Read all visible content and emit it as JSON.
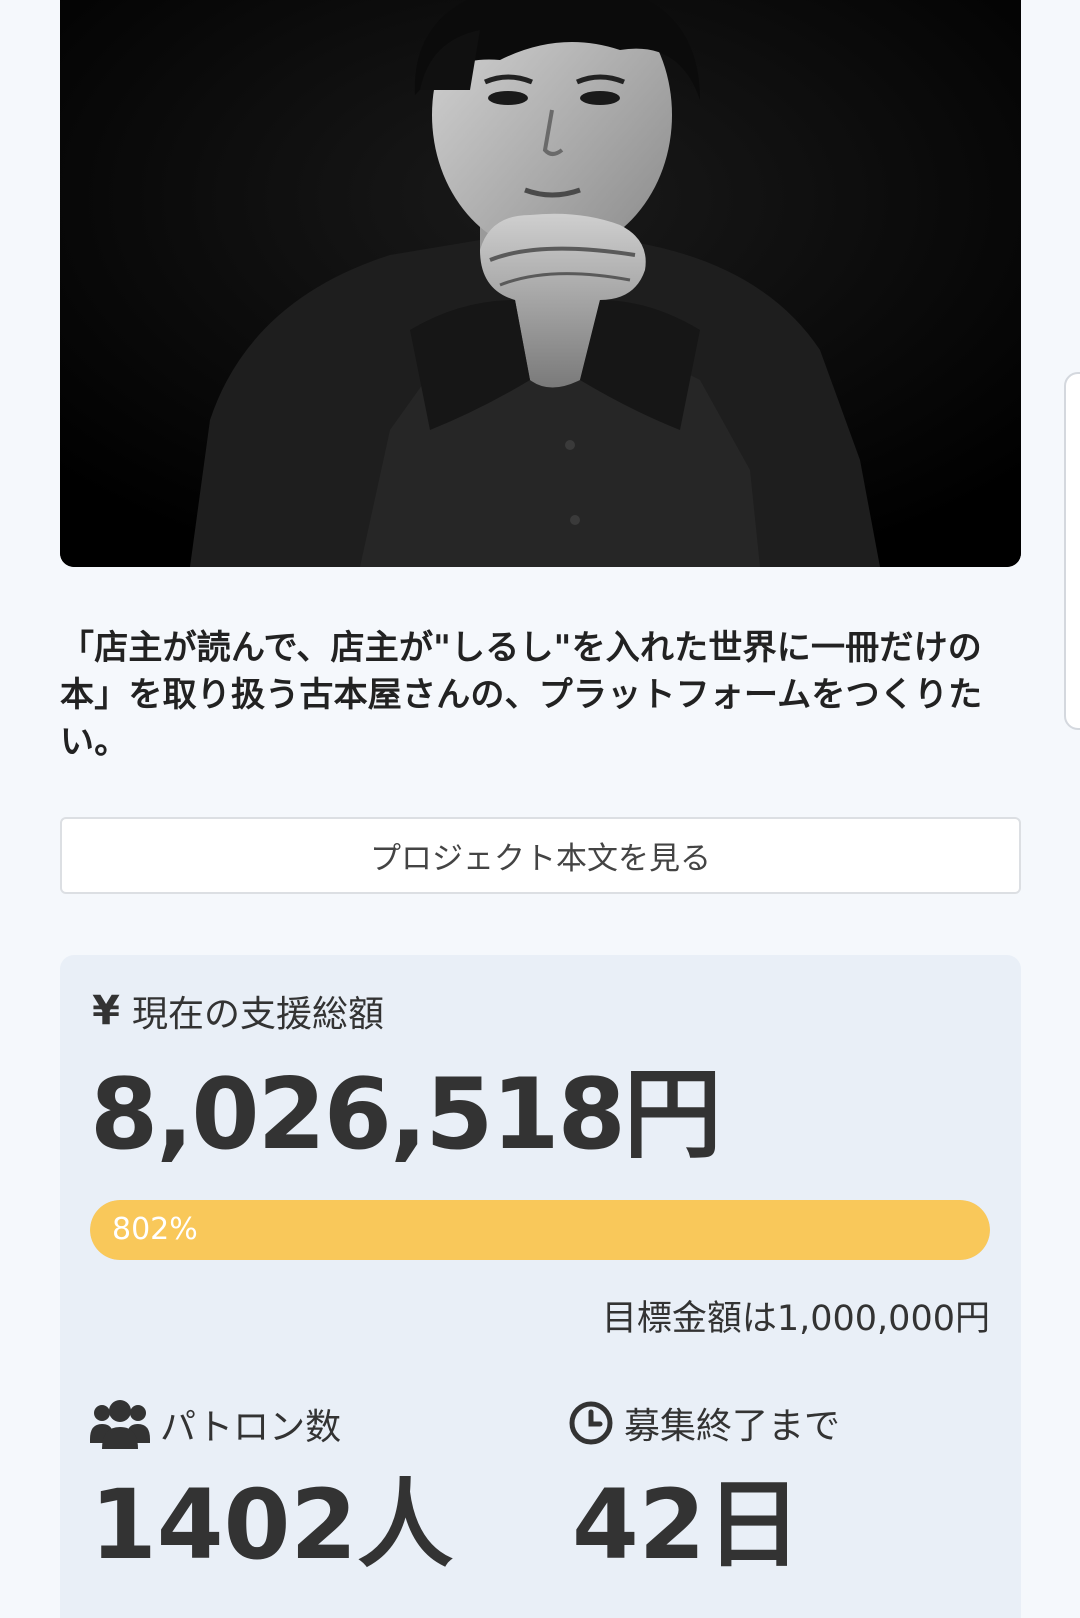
{
  "project": {
    "title": "「店主が読んで、店主が\"しるし\"を入れた世界に一冊だけの本」を取り扱う古本屋さんの、プラットフォームをつくりたい。",
    "view_body_button": "プロジェクト本文を見る"
  },
  "funding": {
    "icon": "yen-icon",
    "label": "現在の支援総額",
    "amount": "8,026,518円",
    "progress_percent": 802,
    "progress_label": "802%",
    "goal_text": "目標金額は1,000,000円"
  },
  "patrons": {
    "icon": "users-icon",
    "label": "パトロン数",
    "count": "1402人"
  },
  "deadline": {
    "icon": "clock-icon",
    "label": "募集終了まで",
    "days": "42日"
  },
  "colors": {
    "background": "#f5f8fc",
    "stats_panel": "#e9eff7",
    "progress": "#f9c85a",
    "text": "#333333"
  }
}
